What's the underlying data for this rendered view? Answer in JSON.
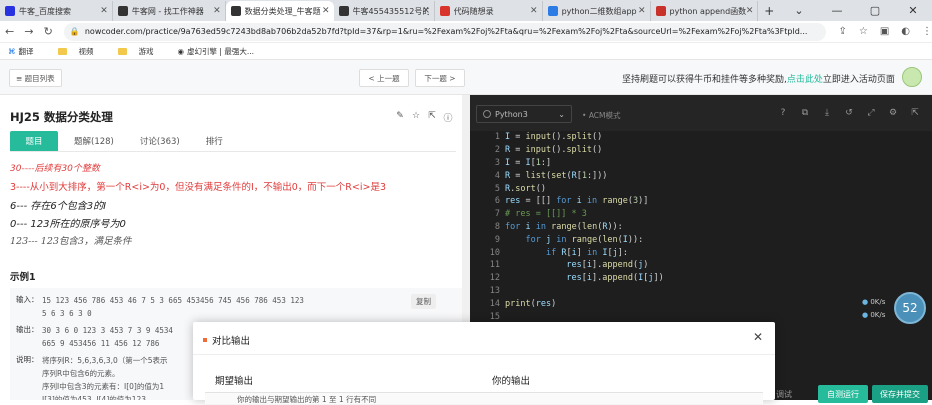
{
  "browser": {
    "tabs": [
      {
        "label": "牛客_百度搜索",
        "color": "#2932e1",
        "active": false
      },
      {
        "label": "牛客网 - 找工作神器",
        "color": "#333333",
        "active": false
      },
      {
        "label": "数据分类处理_牛客题",
        "color": "#333333",
        "active": true
      },
      {
        "label": "牛客455435512号的",
        "color": "#333333",
        "active": false
      },
      {
        "label": "代码随想录",
        "color": "#d9342b",
        "active": false
      },
      {
        "label": "python二维数组app",
        "color": "#2d7be5",
        "active": false
      },
      {
        "label": "python append函数",
        "color": "#c8322b",
        "active": false
      }
    ],
    "new_tab": "+",
    "window_controls": [
      "⌄",
      "—",
      "▢",
      "✕"
    ],
    "url": "nowcoder.com/practice/9a763ed59c7243bd8ab706b2da52b7fd?tpId=37&rp=1&ru=%2Fexam%2Foj%2Fta&qru=%2Fexam%2Foj%2Fta&sourceUrl=%2Fexam%2Foj%2Fta%3Ftpld...",
    "bookmarks": [
      "翻译",
      "视频",
      "游戏",
      "虚幻引擎 | 最强大..."
    ]
  },
  "topbar": {
    "list_btn": "≡ 题目列表",
    "prev_btn": "< 上一题",
    "next_btn": "下一题 >",
    "promo_text": "坚持刷题可以获得牛币和挂件等多种奖励,",
    "promo_link": "点击此处",
    "promo_tail": "立即进入活动页面"
  },
  "question": {
    "title": "HJ25  数据分类处理",
    "tabs": [
      "题目",
      "题解(128)",
      "讨论(363)",
      "排行"
    ],
    "desc": [
      "30----后续有30个整数",
      "3----从小到大排序，第一个R<i>为0，但没有满足条件的I，不输出0，而下一个R<i>是3",
      "6--- 存在6个包含3的I",
      "0---   123所在的原序号为0",
      "123---   123包含3，满足条件"
    ],
    "example_title": "示例1",
    "input_label": "输入：",
    "input_val": "15 123 456 786 453 46 7 5 3 665 453456 745 456 786 453 123\n5 6 3 6 3 0",
    "copy": "复制",
    "output_label": "输出：",
    "output_val": "30 3 6 0 123 3 453 7 3 9 4534\n665 9 453456 11 456 12 786",
    "note_label": "说明：",
    "note_val": "将序列R：5,6,3,6,3,0（第一个5表示\n序列R中包含6的元素。\n序列I中包含3的元素有：I[0]的值为1\nI[3]的值为453, I[4]的值为123..."
  },
  "editor": {
    "language": "Python3",
    "mode": "ACM模式",
    "lines": [
      "1",
      "2",
      "3",
      "4",
      "5",
      "6",
      "7",
      "8",
      "9",
      "10",
      "11",
      "12",
      "13",
      "14",
      "15"
    ],
    "run_btn": "自测运行",
    "submit_btn": "保存并提交",
    "extra_btn": "调试",
    "speed_up": "0K/s",
    "speed_down": "0K/s",
    "score": "52"
  },
  "dialog": {
    "title": "对比输出",
    "close": "✕",
    "expected": "期望输出",
    "yours": "你的输出",
    "diff": "你的输出与期望输出的第 1 至 1 行有不同"
  }
}
